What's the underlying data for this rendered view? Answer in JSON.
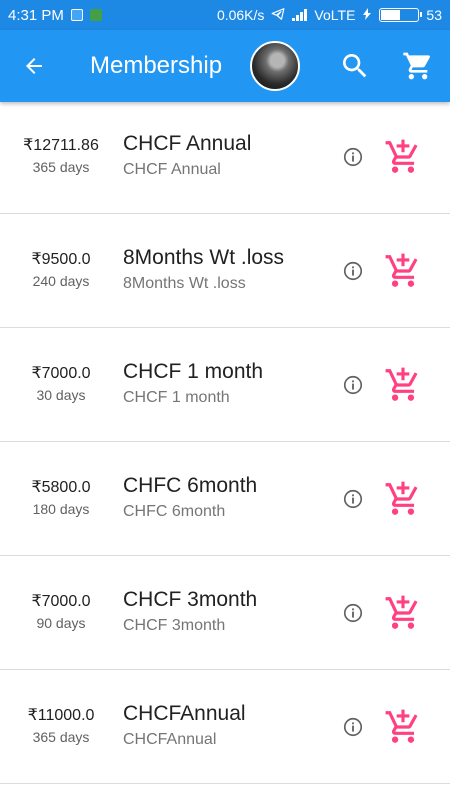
{
  "status_bar": {
    "time": "4:31 PM",
    "network_speed": "0.06K/s",
    "network_type": "VoLTE",
    "battery_level": "53",
    "battery_fraction": 0.53
  },
  "app_bar": {
    "title": "Membership",
    "back_icon": "arrow-back-icon",
    "search_icon": "search-icon",
    "cart_icon": "shopping-cart-icon",
    "background": "#2196f3"
  },
  "colors": {
    "accent": "#ff4081",
    "status_bar": "#1e88e5"
  },
  "plans": [
    {
      "price": "₹12711.86",
      "days": "365 days",
      "name": "CHCF Annual",
      "subtitle": "CHCF Annual"
    },
    {
      "price": "₹9500.0",
      "days": "240 days",
      "name": "8Months Wt .loss",
      "subtitle": "8Months Wt .loss"
    },
    {
      "price": "₹7000.0",
      "days": "30 days",
      "name": "CHCF 1 month",
      "subtitle": "CHCF 1 month"
    },
    {
      "price": "₹5800.0",
      "days": "180 days",
      "name": "CHFC 6month",
      "subtitle": "CHFC 6month"
    },
    {
      "price": "₹7000.0",
      "days": "90 days",
      "name": "CHCF 3month",
      "subtitle": "CHCF 3month"
    },
    {
      "price": "₹11000.0",
      "days": "365 days",
      "name": "CHCFAnnual",
      "subtitle": "CHCFAnnual"
    }
  ]
}
